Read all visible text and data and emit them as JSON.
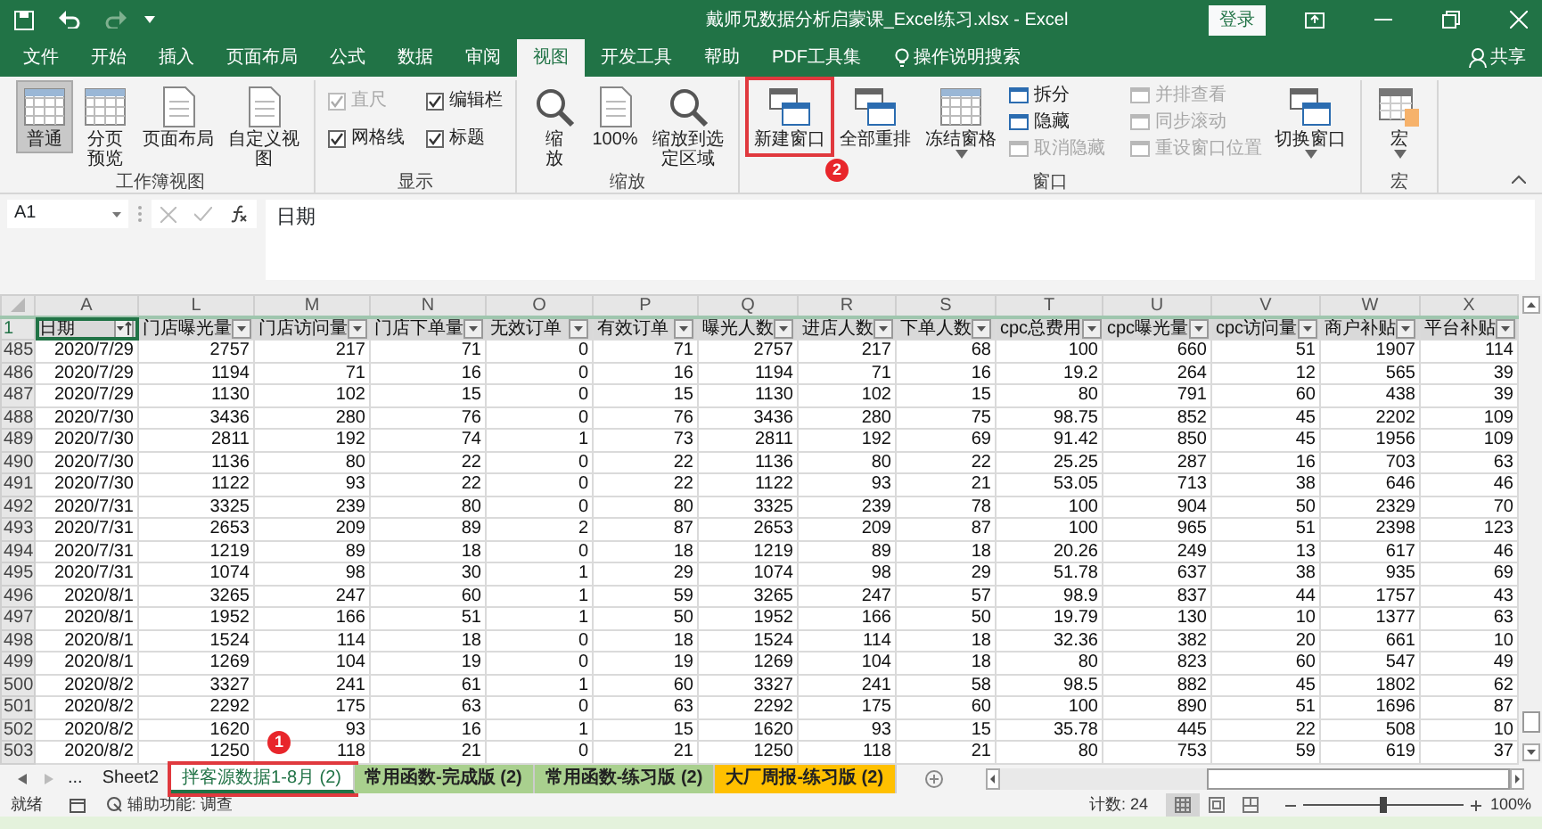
{
  "title_bar": {
    "title": "戴师兄数据分析启蒙课_Excel练习.xlsx  -  Excel",
    "login_button": "登录"
  },
  "menu_tabs": [
    {
      "label": "文件",
      "selected": false
    },
    {
      "label": "开始",
      "selected": false
    },
    {
      "label": "插入",
      "selected": false
    },
    {
      "label": "页面布局",
      "selected": false
    },
    {
      "label": "公式",
      "selected": false
    },
    {
      "label": "数据",
      "selected": false
    },
    {
      "label": "审阅",
      "selected": false
    },
    {
      "label": "视图",
      "selected": true
    },
    {
      "label": "开发工具",
      "selected": false
    },
    {
      "label": "帮助",
      "selected": false
    },
    {
      "label": "PDF工具集",
      "selected": false
    }
  ],
  "tell_me": "操作说明搜索",
  "share": "共享",
  "ribbon": {
    "groups": [
      {
        "label": "工作簿视图",
        "items": [
          {
            "kind": "big",
            "label": "普通",
            "selected": true
          },
          {
            "kind": "big",
            "label": "分页预览",
            "selected": false
          },
          {
            "kind": "big",
            "label": "页面布局",
            "selected": false
          },
          {
            "kind": "big",
            "label": "自定义视图",
            "selected": false
          }
        ]
      },
      {
        "label": "显示",
        "items": [
          {
            "kind": "check",
            "label": "直尺",
            "checked": true,
            "disabled": true
          },
          {
            "kind": "check",
            "label": "编辑栏",
            "checked": true,
            "disabled": false
          },
          {
            "kind": "check",
            "label": "网格线",
            "checked": true,
            "disabled": false
          },
          {
            "kind": "check",
            "label": "标题",
            "checked": true,
            "disabled": false
          }
        ]
      },
      {
        "label": "缩放",
        "items": [
          {
            "kind": "big",
            "label": "缩放"
          },
          {
            "kind": "big",
            "label": "100%"
          },
          {
            "kind": "big",
            "label": "缩放到选定区域"
          }
        ]
      },
      {
        "label": "窗口",
        "items": [
          {
            "kind": "big",
            "label": "新建窗口",
            "highlighted": true,
            "badge": "2"
          },
          {
            "kind": "big",
            "label": "全部重排"
          },
          {
            "kind": "big",
            "label": "冻结窗格",
            "dropdown": true
          },
          {
            "kind": "small",
            "label": "拆分",
            "disabled": false
          },
          {
            "kind": "small",
            "label": "隐藏",
            "disabled": false
          },
          {
            "kind": "small",
            "label": "取消隐藏",
            "disabled": true
          },
          {
            "kind": "small",
            "label": "并排查看",
            "disabled": true
          },
          {
            "kind": "small",
            "label": "同步滚动",
            "disabled": true
          },
          {
            "kind": "small",
            "label": "重设窗口位置",
            "disabled": true
          },
          {
            "kind": "big",
            "label": "切换窗口",
            "dropdown": true
          }
        ]
      },
      {
        "label": "宏",
        "items": [
          {
            "kind": "big",
            "label": "宏",
            "dropdown": true
          }
        ]
      }
    ]
  },
  "formula_bar": {
    "name_box": "A1",
    "formula": "日期"
  },
  "sheet": {
    "columns": [
      "A",
      "L",
      "M",
      "N",
      "O",
      "P",
      "Q",
      "R",
      "S",
      "T",
      "U",
      "V",
      "W",
      "X"
    ],
    "header_row": {
      "number": "1",
      "cells": [
        {
          "text": "日期",
          "sorted": true,
          "active": true
        },
        {
          "text": "门店曝光量",
          "sorted": false,
          "active": false
        },
        {
          "text": "门店访问量",
          "sorted": false,
          "active": false
        },
        {
          "text": "门店下单量",
          "sorted": false,
          "active": false
        },
        {
          "text": "无效订单",
          "sorted": false,
          "active": false
        },
        {
          "text": "有效订单",
          "sorted": false,
          "active": false
        },
        {
          "text": "曝光人数",
          "sorted": false,
          "active": false
        },
        {
          "text": "进店人数",
          "sorted": false,
          "active": false
        },
        {
          "text": "下单人数",
          "sorted": false,
          "active": false
        },
        {
          "text": "cpc总费用",
          "sorted": false,
          "active": false
        },
        {
          "text": "cpc曝光量",
          "sorted": false,
          "active": false
        },
        {
          "text": "cpc访问量",
          "sorted": false,
          "active": false
        },
        {
          "text": "商户补贴",
          "sorted": false,
          "active": false
        },
        {
          "text": "平台补贴",
          "sorted": false,
          "active": false
        }
      ]
    },
    "rows": [
      {
        "number": "485",
        "cells": [
          "2020/7/29",
          "2757",
          "217",
          "71",
          "0",
          "71",
          "2757",
          "217",
          "68",
          "100",
          "660",
          "51",
          "1907",
          "114"
        ]
      },
      {
        "number": "486",
        "cells": [
          "2020/7/29",
          "1194",
          "71",
          "16",
          "0",
          "16",
          "1194",
          "71",
          "16",
          "19.2",
          "264",
          "12",
          "565",
          "39"
        ]
      },
      {
        "number": "487",
        "cells": [
          "2020/7/29",
          "1130",
          "102",
          "15",
          "0",
          "15",
          "1130",
          "102",
          "15",
          "80",
          "791",
          "60",
          "438",
          "39"
        ]
      },
      {
        "number": "488",
        "cells": [
          "2020/7/30",
          "3436",
          "280",
          "76",
          "0",
          "76",
          "3436",
          "280",
          "75",
          "98.75",
          "852",
          "45",
          "2202",
          "109"
        ]
      },
      {
        "number": "489",
        "cells": [
          "2020/7/30",
          "2811",
          "192",
          "74",
          "1",
          "73",
          "2811",
          "192",
          "69",
          "91.42",
          "850",
          "45",
          "1956",
          "109"
        ]
      },
      {
        "number": "490",
        "cells": [
          "2020/7/30",
          "1136",
          "80",
          "22",
          "0",
          "22",
          "1136",
          "80",
          "22",
          "25.25",
          "287",
          "16",
          "703",
          "63"
        ]
      },
      {
        "number": "491",
        "cells": [
          "2020/7/30",
          "1122",
          "93",
          "22",
          "0",
          "22",
          "1122",
          "93",
          "21",
          "53.05",
          "713",
          "38",
          "646",
          "46"
        ]
      },
      {
        "number": "492",
        "cells": [
          "2020/7/31",
          "3325",
          "239",
          "80",
          "0",
          "80",
          "3325",
          "239",
          "78",
          "100",
          "904",
          "50",
          "2329",
          "70"
        ]
      },
      {
        "number": "493",
        "cells": [
          "2020/7/31",
          "2653",
          "209",
          "89",
          "2",
          "87",
          "2653",
          "209",
          "87",
          "100",
          "965",
          "51",
          "2398",
          "123"
        ]
      },
      {
        "number": "494",
        "cells": [
          "2020/7/31",
          "1219",
          "89",
          "18",
          "0",
          "18",
          "1219",
          "89",
          "18",
          "20.26",
          "249",
          "13",
          "617",
          "46"
        ]
      },
      {
        "number": "495",
        "cells": [
          "2020/7/31",
          "1074",
          "98",
          "30",
          "1",
          "29",
          "1074",
          "98",
          "29",
          "51.78",
          "637",
          "38",
          "935",
          "69"
        ]
      },
      {
        "number": "496",
        "cells": [
          "2020/8/1",
          "3265",
          "247",
          "60",
          "1",
          "59",
          "3265",
          "247",
          "57",
          "98.9",
          "837",
          "44",
          "1757",
          "43"
        ]
      },
      {
        "number": "497",
        "cells": [
          "2020/8/1",
          "1952",
          "166",
          "51",
          "1",
          "50",
          "1952",
          "166",
          "50",
          "19.79",
          "130",
          "10",
          "1377",
          "63"
        ]
      },
      {
        "number": "498",
        "cells": [
          "2020/8/1",
          "1524",
          "114",
          "18",
          "0",
          "18",
          "1524",
          "114",
          "18",
          "32.36",
          "382",
          "20",
          "661",
          "10"
        ]
      },
      {
        "number": "499",
        "cells": [
          "2020/8/1",
          "1269",
          "104",
          "19",
          "0",
          "19",
          "1269",
          "104",
          "18",
          "80",
          "823",
          "60",
          "547",
          "49"
        ]
      },
      {
        "number": "500",
        "cells": [
          "2020/8/2",
          "3327",
          "241",
          "61",
          "1",
          "60",
          "3327",
          "241",
          "58",
          "98.5",
          "882",
          "45",
          "1802",
          "62"
        ]
      },
      {
        "number": "501",
        "cells": [
          "2020/8/2",
          "2292",
          "175",
          "63",
          "0",
          "63",
          "2292",
          "175",
          "60",
          "100",
          "890",
          "51",
          "1696",
          "87"
        ]
      },
      {
        "number": "502",
        "cells": [
          "2020/8/2",
          "1620",
          "93",
          "16",
          "1",
          "15",
          "1620",
          "93",
          "15",
          "35.78",
          "445",
          "22",
          "508",
          "10"
        ]
      },
      {
        "number": "503",
        "cells": [
          "2020/8/2",
          "1250",
          "118",
          "21",
          "0",
          "21",
          "1250",
          "118",
          "21",
          "80",
          "753",
          "59",
          "619",
          "37"
        ]
      }
    ]
  },
  "sheet_tabs": {
    "more": "...",
    "tabs": [
      {
        "label": "Sheet2",
        "selected": false
      },
      {
        "label": "拌客源数据1-8月 (2)",
        "selected": true,
        "highlighted": true,
        "badge": "1"
      },
      {
        "label": "常用函数-完成版 (2)",
        "selected": false,
        "color": "#a9d08e"
      },
      {
        "label": "常用函数-练习版 (2)",
        "selected": false,
        "color": "#a9d08e"
      },
      {
        "label": "大厂周报-练习版 (2)",
        "selected": false,
        "color": "#ffc000"
      }
    ]
  },
  "status_bar": {
    "ready": "就绪",
    "accessibility": "辅助功能: 调查",
    "count": "计数: 24",
    "views": [
      {
        "selected": true
      },
      {
        "selected": false
      },
      {
        "selected": false
      }
    ],
    "zoom": {
      "level": 0.5,
      "reading": "100%"
    }
  }
}
